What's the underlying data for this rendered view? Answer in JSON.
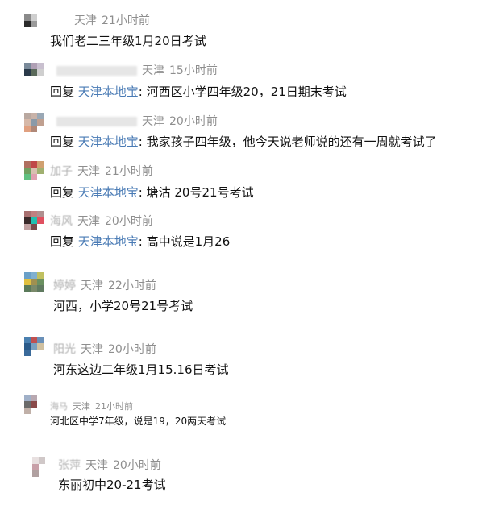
{
  "comments": [
    {
      "name": "",
      "location": "天津",
      "time": "21小时前",
      "reply_prefix": "",
      "reply_target": "",
      "colon": "",
      "text": "我们老二三年级1月20日考试",
      "avatar": [
        "#8a8a8a",
        "#cfcfcf",
        "#ffffff",
        "#2b2b2b",
        "#9a9a9a",
        "#ffffff",
        "#ffffff",
        "#ffffff",
        "#ffffff"
      ]
    },
    {
      "name": "",
      "location": "天津",
      "time": "15小时前",
      "reply_prefix": "回复",
      "reply_target": "天津本地宝",
      "colon": ":",
      "text": "河西区小学四年级20，21日期末考试",
      "avatar": [
        "#7a8a9a",
        "#b0a0b5",
        "#c9c0cf",
        "#2a3a4a",
        "#5a6a5a",
        "#cfcfcf",
        "#ffffff",
        "#ffffff",
        "#ffffff"
      ]
    },
    {
      "name": "",
      "location": "天津",
      "time": "20小时前",
      "reply_prefix": "回复",
      "reply_target": "天津本地宝",
      "colon": ":",
      "text": "我家孩子四年级，他今天说老师说的还有一周就考试了",
      "avatar": [
        "#b9a8a0",
        "#c8b2a8",
        "#9aa8b5",
        "#d6b8a8",
        "#8a9aa8",
        "#c0a090",
        "#e0a080",
        "#b08878",
        "#ffffff"
      ]
    },
    {
      "name": "加子",
      "location": "天津",
      "time": "21小时前",
      "reply_prefix": "回复",
      "reply_target": "天津本地宝",
      "colon": ":",
      "text": "塘沽 20号21号考试",
      "avatar": [
        "#b07060",
        "#c04848",
        "#d0a070",
        "#70a060",
        "#d8c0b0",
        "#a0b070",
        "#60c080",
        "#e0a0b0",
        "#ffffff"
      ]
    },
    {
      "name": "海风",
      "location": "天津",
      "time": "20小时前",
      "reply_prefix": "回复",
      "reply_target": "天津本地宝",
      "colon": ":",
      "text": "高中说是1月26",
      "avatar": [
        "#a87070",
        "#c08080",
        "#b09090",
        "#3a2a2a",
        "#20c0b0",
        "#e05060",
        "#c0a0a0",
        "#7a4a4a",
        "#ffffff"
      ]
    },
    {
      "name": "婷婷",
      "location": "天津",
      "time": "22小时前",
      "reply_prefix": "",
      "reply_target": "",
      "colon": "",
      "text": "河西，小学20号21号考试",
      "avatar": [
        "#6aa0c8",
        "#80b0d0",
        "#c0c060",
        "#e0c040",
        "#a09050",
        "#6a9060",
        "#5a7a5a",
        "#7a8a6a",
        "#607a60"
      ]
    },
    {
      "name": "阳光",
      "location": "天津",
      "time": "20小时前",
      "reply_prefix": "",
      "reply_target": "",
      "colon": "",
      "text": "河东这边二年级1月15.16日考试",
      "avatar": [
        "#4a80b0",
        "#c05050",
        "#6a90b8",
        "#2a5a8a",
        "#7aa0c0",
        "#d0c0a0",
        "#3a6a9a",
        "#ffffff",
        "#ffffff"
      ]
    },
    {
      "name": "海马",
      "location": "天津",
      "time": "21小时前",
      "reply_prefix": "",
      "reply_target": "",
      "colon": "",
      "text": "河北区中学7年级，说是19，20两天考试",
      "avatar": [
        "#a0b0c8",
        "#b8a8b0",
        "#ffffff",
        "#6a6a6a",
        "#8a4a4a",
        "#ffffff",
        "#c0b0a8",
        "#ffffff",
        "#ffffff"
      ]
    },
    {
      "name": "张萍",
      "location": "天津",
      "time": "20小时前",
      "reply_prefix": "",
      "reply_target": "",
      "colon": "",
      "text": "东丽初中20-21考试",
      "avatar": [
        "#e8e0e0",
        "#d0c8c8",
        "#ffffff",
        "#c8a0a8",
        "#ffffff",
        "#ffffff",
        "#b0a0a0",
        "#ffffff",
        "#ffffff"
      ]
    }
  ]
}
